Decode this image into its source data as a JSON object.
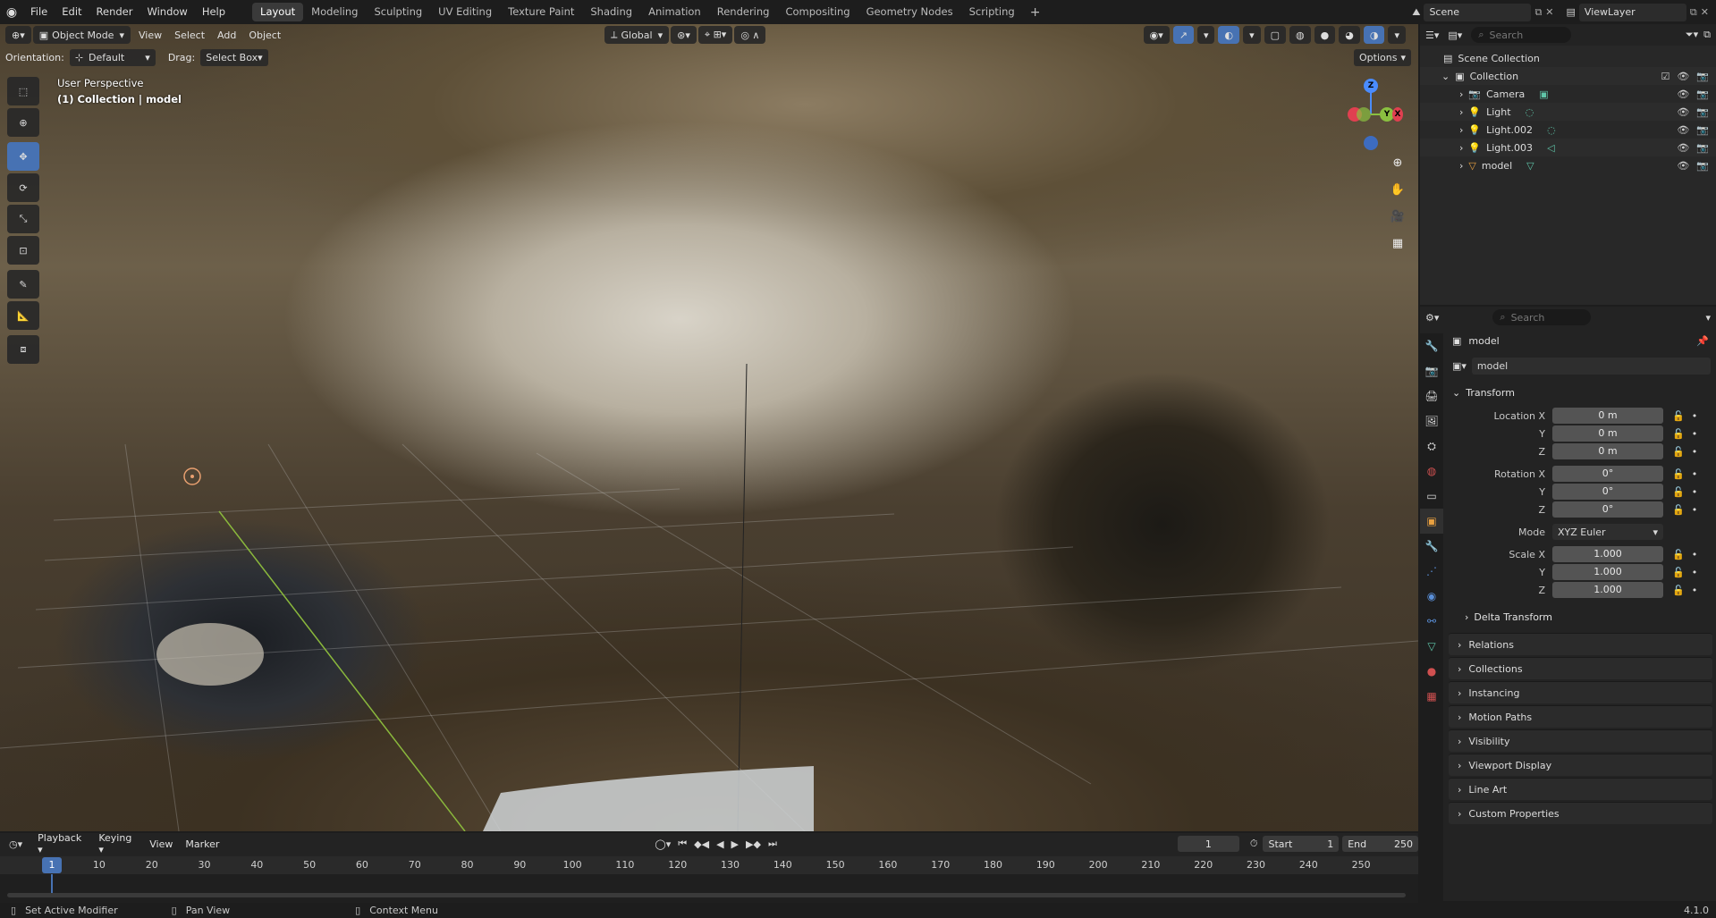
{
  "topbar": {
    "menus": [
      "File",
      "Edit",
      "Render",
      "Window",
      "Help"
    ],
    "workspaces": [
      "Layout",
      "Modeling",
      "Sculpting",
      "UV Editing",
      "Texture Paint",
      "Shading",
      "Animation",
      "Rendering",
      "Compositing",
      "Geometry Nodes",
      "Scripting"
    ],
    "active_workspace": "Layout",
    "scene_name": "Scene",
    "view_layer": "ViewLayer"
  },
  "viewport": {
    "mode": "Object Mode",
    "menus": [
      "View",
      "Select",
      "Add",
      "Object"
    ],
    "transform_orientation": "Global",
    "orientation_label": "Orientation:",
    "orientation_value": "Default",
    "drag_label": "Drag:",
    "drag_value": "Select Box",
    "options_label": "Options",
    "view_name": "User Perspective",
    "collection_info": "(1) Collection | model",
    "gizmo": {
      "x": "X",
      "y": "Y",
      "z": "Z"
    }
  },
  "outliner": {
    "search_placeholder": "Search",
    "root": "Scene Collection",
    "collection": "Collection",
    "items": [
      {
        "name": "Camera",
        "icon": "camera-icon"
      },
      {
        "name": "Light",
        "icon": "light-icon"
      },
      {
        "name": "Light.002",
        "icon": "light-icon"
      },
      {
        "name": "Light.003",
        "icon": "light-icon"
      },
      {
        "name": "model",
        "icon": "mesh-icon"
      }
    ]
  },
  "properties": {
    "search_placeholder": "Search",
    "object_name": "model",
    "datablock_name": "model",
    "transform": {
      "title": "Transform",
      "location_label": "Location X",
      "location": [
        "0 m",
        "0 m",
        "0 m"
      ],
      "rotation_label": "Rotation X",
      "rotation": [
        "0°",
        "0°",
        "0°"
      ],
      "mode_label": "Mode",
      "mode_value": "XYZ Euler",
      "scale_label": "Scale X",
      "scale": [
        "1.000",
        "1.000",
        "1.000"
      ],
      "y_label": "Y",
      "z_label": "Z"
    },
    "delta_transform": "Delta Transform",
    "panels": [
      "Relations",
      "Collections",
      "Instancing",
      "Motion Paths",
      "Visibility",
      "Viewport Display",
      "Line Art",
      "Custom Properties"
    ]
  },
  "timeline": {
    "menus": [
      "Playback",
      "Keying",
      "View",
      "Marker"
    ],
    "current_frame": "1",
    "start_label": "Start",
    "start": "1",
    "end_label": "End",
    "end": "250",
    "ruler_labels": [
      "1",
      "10",
      "20",
      "30",
      "40",
      "50",
      "60",
      "70",
      "80",
      "90",
      "100",
      "110",
      "120",
      "130",
      "140",
      "150",
      "160",
      "170",
      "180",
      "190",
      "200",
      "210",
      "220",
      "230",
      "240",
      "250"
    ]
  },
  "statusbar": {
    "left": "Set Active Modifier",
    "middle": "Pan View",
    "right": "Context Menu",
    "version": "4.1.0"
  }
}
